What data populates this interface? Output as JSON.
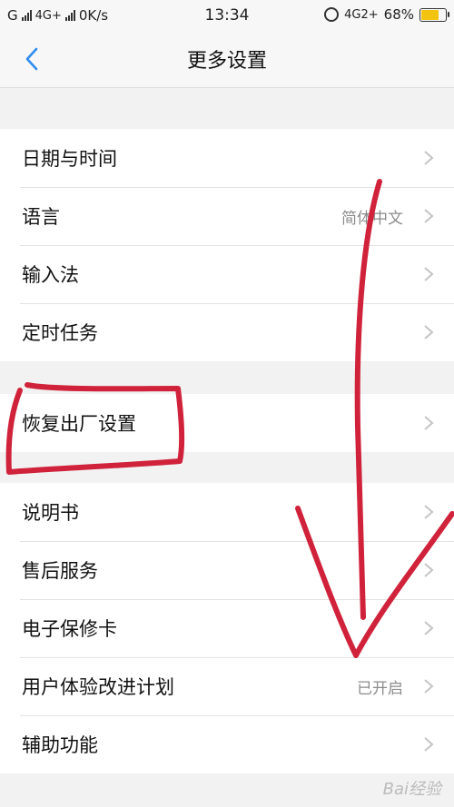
{
  "status_bar": {
    "carrier1": "G",
    "network": "4G+",
    "speed": "0K/s",
    "time": "13:34",
    "network_right": "4G2+",
    "battery_percent": "68%",
    "battery_level": 0.68,
    "battery_color": "#f2c40f"
  },
  "header": {
    "back_icon": "chevron-left-icon",
    "title": "更多设置",
    "accent_color": "#2f8cf0"
  },
  "groups": [
    {
      "items": [
        {
          "label": "日期与时间",
          "value": ""
        },
        {
          "label": "语言",
          "value": "简体中文"
        },
        {
          "label": "输入法",
          "value": ""
        },
        {
          "label": "定时任务",
          "value": ""
        }
      ]
    },
    {
      "items": [
        {
          "label": "恢复出厂设置",
          "value": ""
        }
      ]
    },
    {
      "items": [
        {
          "label": "说明书",
          "value": ""
        },
        {
          "label": "售后服务",
          "value": ""
        },
        {
          "label": "电子保修卡",
          "value": ""
        },
        {
          "label": "用户体验改进计划",
          "value": "已开启"
        },
        {
          "label": "辅助功能",
          "value": ""
        }
      ]
    }
  ],
  "annotation_color": "#d0223a",
  "watermark": "Bai经验"
}
